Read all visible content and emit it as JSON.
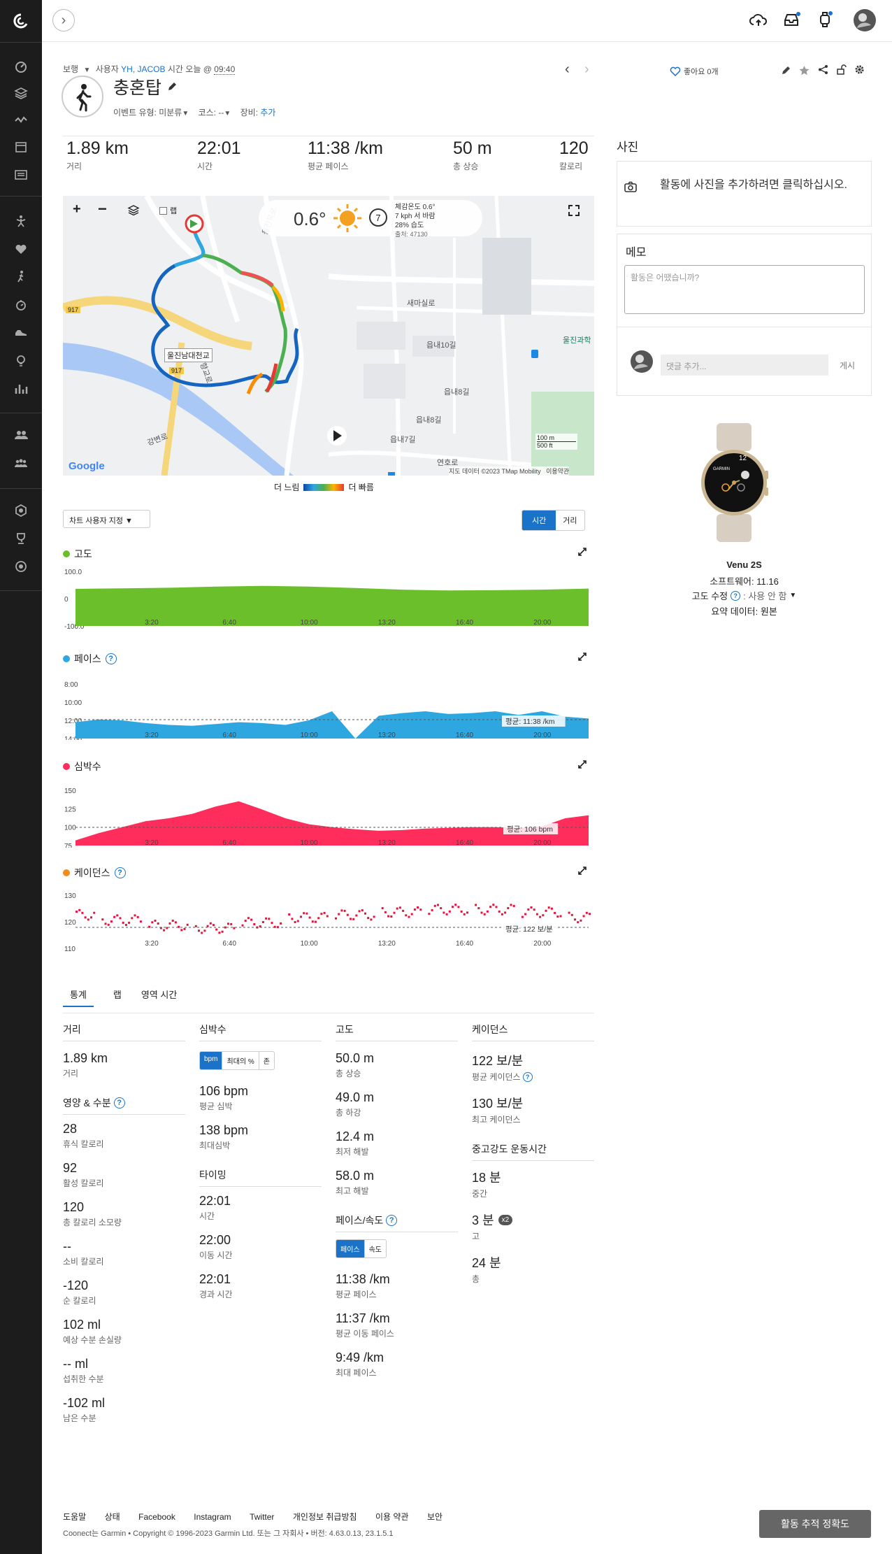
{
  "topbar": {
    "expand_label": "›"
  },
  "activity": {
    "meta_type": "보행",
    "meta_by": "사용자",
    "meta_user": "YH, JACOB",
    "meta_time_label": "시간 오늘 @",
    "meta_time": "09:40",
    "title": "충혼탑",
    "event_type_label": "이벤트 유형:",
    "event_type_value": "미분류",
    "course_label": "코스:",
    "course_value": "--",
    "gear_label": "장비:",
    "gear_value": "추가"
  },
  "actions": {
    "like_label": "좋아요 0개"
  },
  "stats_strip": [
    {
      "value": "1.89 km",
      "label": "거리"
    },
    {
      "value": "22:01",
      "label": "시간"
    },
    {
      "value": "11:38 /km",
      "label": "평균 페이스"
    },
    {
      "value": "50 m",
      "label": "총 상승"
    },
    {
      "value": "120",
      "label": "칼로리"
    }
  ],
  "map": {
    "layer_checkbox_label": "랩",
    "temp": "0.6°",
    "wind_speed": "7",
    "weather_lines": [
      "체감온도 0.6°",
      "7 kph 서 바람",
      "28% 습도",
      "출처: 47130"
    ],
    "scale_m": "100 m",
    "scale_ft": "500 ft",
    "attribution": "지도 데이터 ©2023 TMap Mobility",
    "terms": "이용약관",
    "google": "Google",
    "legend_slow": "더 느림",
    "legend_fast": "더 빠름",
    "labels": {
      "road_917a": "917",
      "road_917b": "917",
      "bridge": "울진남대천교",
      "saemasil": "새마실로",
      "eupnae10": "읍내10길",
      "eupnae8a": "읍내8길",
      "eupnae8b": "읍내8길",
      "eupnae7": "읍내7길",
      "yeonho": "연호로",
      "uljin_science": "울진과학",
      "uljinbuk": "울진북로",
      "ganbyeon": "강변로",
      "hyanggyo": "향교로"
    }
  },
  "chart_controls": {
    "custom_label": "차트 사용자 지정",
    "time_label": "시간",
    "distance_label": "거리"
  },
  "photos": {
    "title": "사진",
    "add_prompt": "활동에 사진을 추가하려면 클릭하십시오."
  },
  "memo": {
    "title": "메모",
    "placeholder": "활동은 어땠습니까?"
  },
  "comment": {
    "placeholder": "댓글 추가...",
    "post_label": "게시"
  },
  "device": {
    "name": "Venu 2S",
    "software": "소프트웨어: 11.16",
    "elev_label": "고도 수정",
    "elev_value": ": 사용 안 함",
    "summary": "요약 데이터: 원본",
    "watch_time": "12",
    "watch_brand": "GARMIN"
  },
  "stats_tabs": {
    "stats": "통계",
    "laps": "랩",
    "zones": "영역 시간"
  },
  "stats": {
    "distance": {
      "head": "거리",
      "items": [
        {
          "v": "1.89 km",
          "l": "거리"
        }
      ]
    },
    "nutrition": {
      "head": "영양 & 수분",
      "items": [
        {
          "v": "28",
          "l": "휴식 칼로리"
        },
        {
          "v": "92",
          "l": "활성 칼로리"
        },
        {
          "v": "120",
          "l": "총 칼로리 소모량"
        },
        {
          "v": "--",
          "l": "소비 칼로리"
        },
        {
          "v": "-120",
          "l": "순 칼로리"
        },
        {
          "v": "102 ml",
          "l": "예상 수분 손실량"
        },
        {
          "v": "-- ml",
          "l": "섭취한 수분"
        },
        {
          "v": "-102 ml",
          "l": "남은 수분"
        }
      ]
    },
    "hr": {
      "head": "심박수",
      "seg": [
        "bpm",
        "최대의 %",
        "존"
      ],
      "items": [
        {
          "v": "106 bpm",
          "l": "평균 심박"
        },
        {
          "v": "138 bpm",
          "l": "최대심박"
        }
      ]
    },
    "timing": {
      "head": "타이밍",
      "items": [
        {
          "v": "22:01",
          "l": "시간"
        },
        {
          "v": "22:00",
          "l": "이동 시간"
        },
        {
          "v": "22:01",
          "l": "경과 시간"
        }
      ]
    },
    "elevation": {
      "head": "고도",
      "items": [
        {
          "v": "50.0 m",
          "l": "총 상승"
        },
        {
          "v": "49.0 m",
          "l": "총 하강"
        },
        {
          "v": "12.4 m",
          "l": "최저 해발"
        },
        {
          "v": "58.0 m",
          "l": "최고 해발"
        }
      ]
    },
    "pace": {
      "head": "페이스/속도",
      "seg": [
        "페이스",
        "속도"
      ],
      "items": [
        {
          "v": "11:38 /km",
          "l": "평균 페이스"
        },
        {
          "v": "11:37 /km",
          "l": "평균 이동 페이스"
        },
        {
          "v": "9:49 /km",
          "l": "최대 페이스"
        }
      ]
    },
    "cadence": {
      "head": "케이던스",
      "items": [
        {
          "v": "122 보/분",
          "l": "평균 케이던스"
        },
        {
          "v": "130 보/분",
          "l": "최고 케이던스"
        }
      ]
    },
    "intensity": {
      "head": "중고강도 운동시간",
      "items": [
        {
          "v": "18 분",
          "l": "중간"
        },
        {
          "v": "3 분",
          "l": "고",
          "badge": "x2"
        },
        {
          "v": "24 분",
          "l": "총"
        }
      ]
    }
  },
  "footer": {
    "links": [
      "도움말",
      "상태",
      "Facebook",
      "Instagram",
      "Twitter",
      "개인정보 취급방침",
      "이용 약관",
      "보안"
    ],
    "copyright": "Coonect는 Garmin • Copyright © 1996-2023 Garmin Ltd. 또는 그 자회사 • 버전: 4.63.0.13, 23.1.5.1",
    "accuracy_button": "활동 추적 정확도"
  },
  "chart_data": [
    {
      "type": "area",
      "title": "고도",
      "color": "#6abf2b",
      "x_ticks": [
        "3:20",
        "6:40",
        "10:00",
        "13:20",
        "16:40",
        "20:00"
      ],
      "y_ticks": [
        "100.0",
        "0",
        "-100.0"
      ],
      "ylim": [
        -100,
        100
      ],
      "x": [
        0,
        2,
        4,
        6,
        8,
        10,
        12,
        14,
        16,
        18,
        20,
        22
      ],
      "values": [
        36,
        38,
        40,
        44,
        47,
        44,
        39,
        33,
        30,
        31,
        33,
        37
      ]
    },
    {
      "type": "area",
      "title": "페이스",
      "color": "#2ea7e0",
      "x_ticks": [
        "3:20",
        "6:40",
        "10:00",
        "13:20",
        "16:40",
        "20:00"
      ],
      "y_ticks": [
        "8:00",
        "10:00",
        "12:00",
        "14:00"
      ],
      "avg_label": "평균: 11:38 /km",
      "x": [
        0,
        1,
        2,
        3,
        4,
        5,
        6,
        7,
        8,
        9,
        10,
        11,
        12,
        13,
        14,
        15,
        16,
        17,
        18,
        19,
        20,
        21,
        22
      ],
      "values": [
        12.2,
        11.9,
        12.0,
        12.3,
        12.5,
        12.6,
        12.4,
        12.2,
        12.3,
        12.5,
        12.0,
        11.0,
        14.0,
        11.5,
        11.2,
        11.0,
        11.3,
        11.2,
        11.0,
        11.4,
        11.0,
        11.6,
        11.8
      ]
    },
    {
      "type": "area",
      "title": "심박수",
      "color": "#ff2d5c",
      "x_ticks": [
        "3:20",
        "6:40",
        "10:00",
        "13:20",
        "16:40",
        "20:00"
      ],
      "y_ticks": [
        "150",
        "125",
        "100",
        "75"
      ],
      "avg_label": "평균: 106 bpm",
      "x": [
        0,
        1,
        2,
        3,
        4,
        5,
        6,
        7,
        8,
        9,
        10,
        11,
        12,
        13,
        14,
        15,
        16,
        17,
        18,
        19,
        20,
        21,
        22
      ],
      "values": [
        82,
        92,
        100,
        108,
        112,
        118,
        128,
        135,
        124,
        112,
        104,
        100,
        97,
        95,
        96,
        98,
        99,
        100,
        100,
        99,
        101,
        112,
        116
      ]
    },
    {
      "type": "scatter",
      "title": "케이던스",
      "color": "#e8123c",
      "x_ticks": [
        "3:20",
        "6:40",
        "10:00",
        "13:20",
        "16:40",
        "20:00"
      ],
      "y_ticks": [
        "130",
        "120",
        "110"
      ],
      "avg_label": "평균: 122 보/분",
      "x": [
        0,
        2,
        4,
        6,
        8,
        10,
        12,
        14,
        16,
        18,
        20,
        22
      ],
      "values": [
        123,
        121,
        119,
        118,
        120,
        122,
        123,
        124,
        125,
        125,
        124,
        122
      ]
    }
  ]
}
